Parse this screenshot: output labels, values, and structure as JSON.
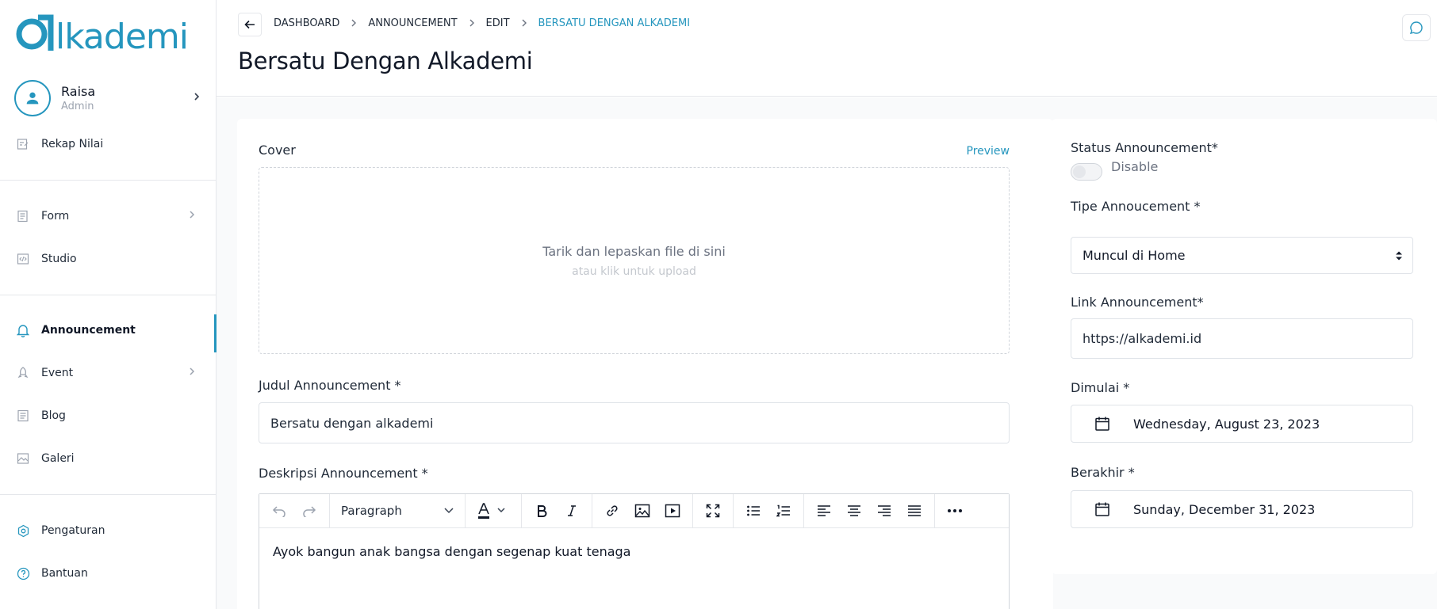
{
  "brand": {
    "name": "alkademi",
    "accent": "#2596be"
  },
  "user": {
    "name": "Raisa",
    "role": "Admin"
  },
  "sidebar": {
    "items": [
      {
        "label": "Rekap Nilai",
        "icon": "edit-note-icon"
      },
      {
        "label": "Form",
        "icon": "form-icon"
      },
      {
        "label": "Studio",
        "icon": "code-icon"
      },
      {
        "label": "Announcement",
        "icon": "bell-icon"
      },
      {
        "label": "Event",
        "icon": "rocket-icon"
      },
      {
        "label": "Blog",
        "icon": "document-icon"
      },
      {
        "label": "Galeri",
        "icon": "gallery-icon"
      },
      {
        "label": "Pengaturan",
        "icon": "settings-icon"
      },
      {
        "label": "Bantuan",
        "icon": "help-icon"
      }
    ]
  },
  "breadcrumb": [
    "DASHBOARD",
    "ANNOUNCEMENT",
    "EDIT",
    "BERSATU DENGAN ALKADEMI"
  ],
  "page": {
    "title": "Bersatu Dengan Alkademi"
  },
  "form": {
    "cover_label": "Cover",
    "preview_label": "Preview",
    "dropzone_title": "Tarik dan lepaskan file di sini",
    "dropzone_sub": "atau klik untuk upload",
    "judul_label": "Judul Announcement *",
    "judul_value": "Bersatu dengan alkademi",
    "deskripsi_label": "Deskripsi Announcement *",
    "paragraph_option": "Paragraph",
    "deskripsi_value": "Ayok bangun anak bangsa dengan segenap kuat tenaga",
    "status_label": "Status Announcement*",
    "status_value": "Disable",
    "tipe_label": "Tipe Annoucement *",
    "tipe_value": "Muncul di Home",
    "link_label": "Link Announcement*",
    "link_value": "https://alkademi.id",
    "dimulai_label": "Dimulai *",
    "dimulai_value": "Wednesday, August 23, 2023",
    "berakhir_label": "Berakhir *",
    "berakhir_value": "Sunday, December 31, 2023"
  }
}
